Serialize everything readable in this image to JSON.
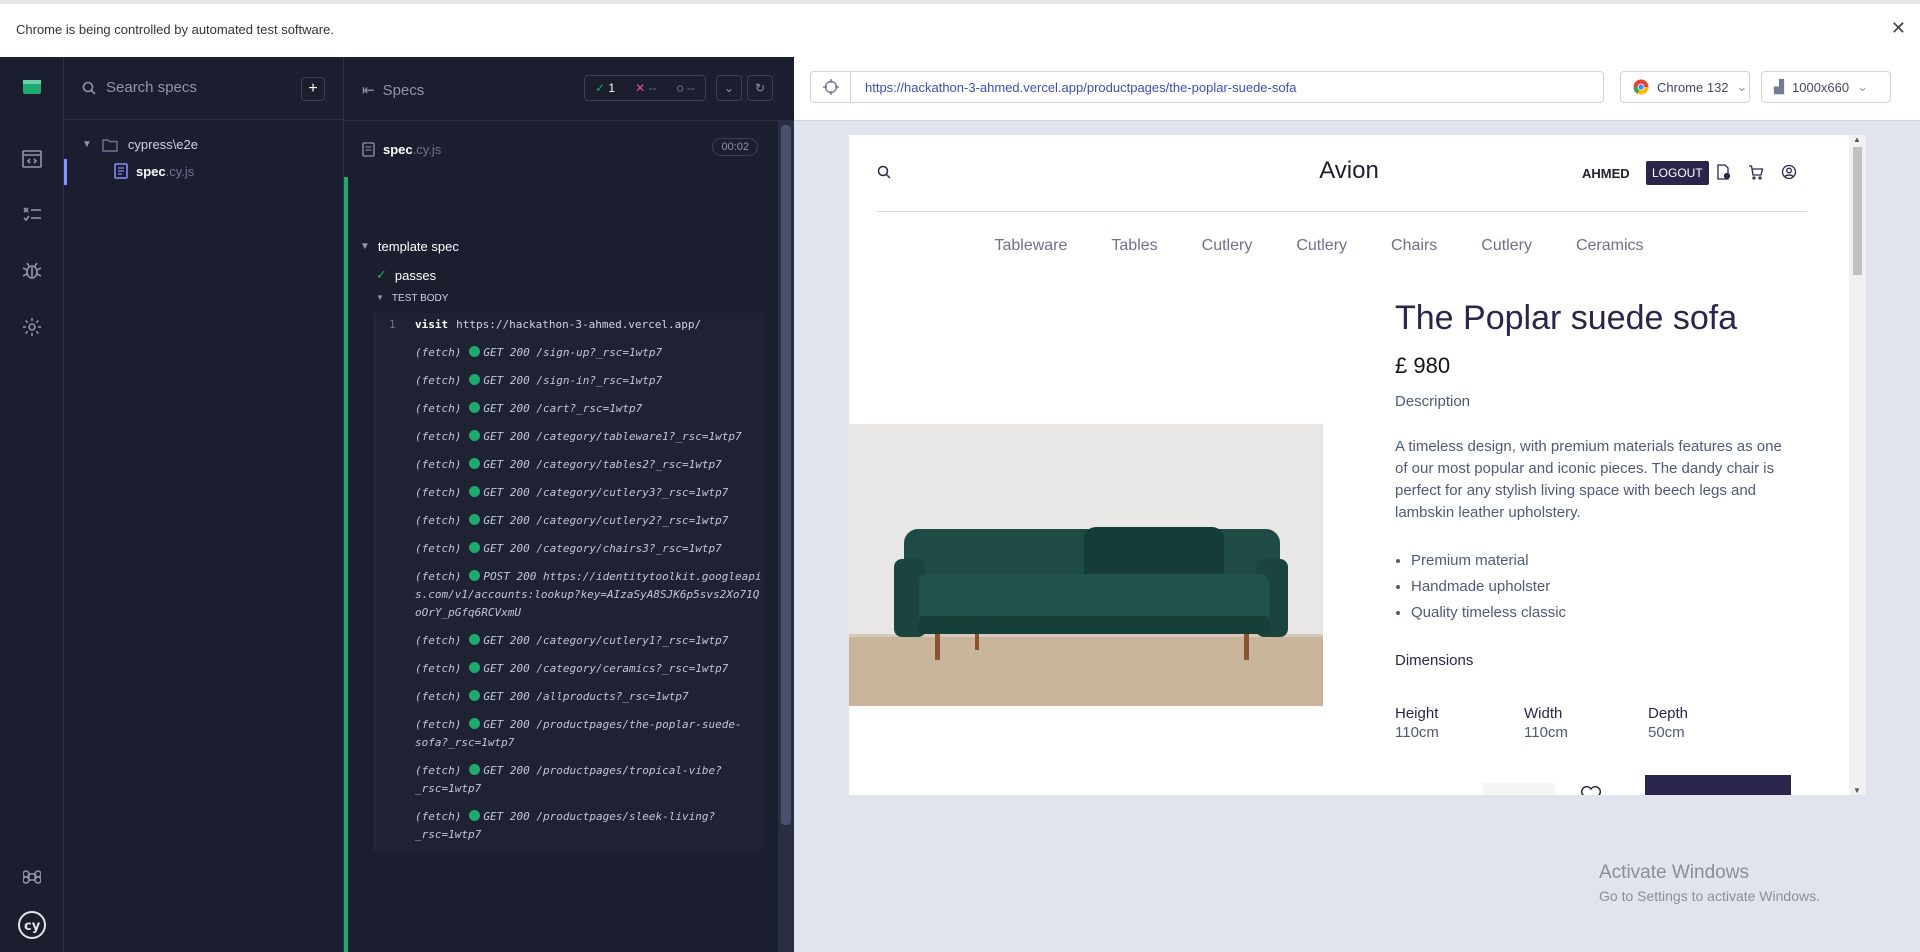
{
  "banner": {
    "text": "Chrome is being controlled by automated test software.",
    "close": "✕"
  },
  "specs_panel": {
    "search_placeholder": "Search specs",
    "add": "+",
    "folder": "cypress\\e2e",
    "file_name": "spec",
    "file_ext": ".cy.js"
  },
  "log": {
    "title": "Specs",
    "passed": "1",
    "failed": "--",
    "pending": "--",
    "spec_name": "spec",
    "spec_ext": ".cy.js",
    "duration": "00:02",
    "suite": "template spec",
    "test": "passes",
    "body_label": "TEST BODY",
    "visit_num": "1",
    "visit_cmd": "visit",
    "visit_url": "https://hackathon-3-ahmed.vercel.app/",
    "commands": [
      {
        "type": "(fetch)",
        "text": "GET 200 /sign-up?_rsc=1wtp7"
      },
      {
        "type": "(fetch)",
        "text": "GET 200 /sign-in?_rsc=1wtp7"
      },
      {
        "type": "(fetch)",
        "text": "GET 200 /cart?_rsc=1wtp7"
      },
      {
        "type": "(fetch)",
        "text": "GET 200 /category/tableware1?_rsc=1wtp7"
      },
      {
        "type": "(fetch)",
        "text": "GET 200 /category/tables2?_rsc=1wtp7"
      },
      {
        "type": "(fetch)",
        "text": "GET 200 /category/cutlery3?_rsc=1wtp7"
      },
      {
        "type": "(fetch)",
        "text": "GET 200 /category/cutlery2?_rsc=1wtp7"
      },
      {
        "type": "(fetch)",
        "text": "GET 200 /category/chairs3?_rsc=1wtp7"
      },
      {
        "type": "(fetch)",
        "text": "POST 200 https://identitytoolkit.googleapis.com/v1/accounts:lookup?key=AIzaSyA8SJK6p5svs2Xo71QoOrY_pGfq6RCVxmU"
      },
      {
        "type": "(fetch)",
        "text": "GET 200 /category/cutlery1?_rsc=1wtp7"
      },
      {
        "type": "(fetch)",
        "text": "GET 200 /category/ceramics?_rsc=1wtp7"
      },
      {
        "type": "(fetch)",
        "text": "GET 200 /allproducts?_rsc=1wtp7"
      },
      {
        "type": "(fetch)",
        "text": "GET 200 /productpages/the-poplar-suede-sofa?_rsc=1wtp7"
      },
      {
        "type": "(fetch)",
        "text": "GET 200 /productpages/tropical-vibe?_rsc=1wtp7"
      },
      {
        "type": "(fetch)",
        "text": "GET 200 /productpages/sleek-living?_rsc=1wtp7"
      }
    ]
  },
  "aut": {
    "url": "https://hackathon-3-ahmed.vercel.app/productpages/the-poplar-suede-sofa",
    "browser": "Chrome 132",
    "viewport": "1000x660"
  },
  "site": {
    "logo": "Avion",
    "user": "AHMED",
    "logout": "LOGOUT",
    "nav": [
      "Tableware",
      "Tables",
      "Cutlery",
      "Cutlery",
      "Chairs",
      "Cutlery",
      "Ceramics"
    ],
    "product": {
      "title": "The Poplar suede sofa",
      "price": "£ 980",
      "description_label": "Description",
      "description": "A timeless design, with premium materials features as one of our most popular and iconic pieces. The dandy chair is perfect for any stylish living space with beech legs and lambskin leather upholstery.",
      "features": [
        "Premium material",
        "Handmade upholster",
        "Quality timeless classic"
      ],
      "dimensions_label": "Dimensions",
      "dimensions": [
        {
          "label": "Height",
          "value": "110cm"
        },
        {
          "label": "Width",
          "value": "110cm"
        },
        {
          "label": "Depth",
          "value": "50cm"
        }
      ]
    }
  },
  "watermark": {
    "title": "Activate Windows",
    "subtitle": "Go to Settings to activate Windows."
  },
  "colors": {
    "pass": "#1fa971",
    "fail": "#e45770",
    "brand": "#2a254b"
  }
}
